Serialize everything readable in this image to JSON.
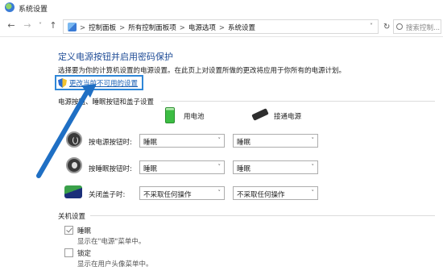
{
  "window": {
    "title": "系统设置"
  },
  "nav": {
    "back_icon": "arrow-left-icon",
    "forward_icon": "arrow-right-icon",
    "up_icon": "arrow-up-icon",
    "breadcrumbs": [
      "控制面板",
      "所有控制面板项",
      "电源选项",
      "系统设置"
    ],
    "search_placeholder": "搜索控制..."
  },
  "page": {
    "heading": "定义电源按钮并启用密码保护",
    "subtext": "选择要为你的计算机设置的电源设置。在此页上对设置所做的更改将应用于你所有的电源计划。",
    "change_link": "更改当前不可用的设置",
    "section_power": "电源按钮、睡眠按钮和盖子设置",
    "col_battery": "用电池",
    "col_plugged": "接通电源",
    "rows": [
      {
        "label": "按电源按钮时:",
        "battery": "睡眠",
        "plugged": "睡眠"
      },
      {
        "label": "按睡眠按钮时:",
        "battery": "睡眠",
        "plugged": "睡眠"
      },
      {
        "label": "关闭盖子时:",
        "battery": "不采取任何操作",
        "plugged": "不采取任何操作"
      }
    ],
    "section_shutdown": "关机设置",
    "options": [
      {
        "label": "睡眠",
        "desc": "显示在\"电源\"菜单中。",
        "checked": true
      },
      {
        "label": "锁定",
        "desc": "显示在用户头像菜单中。",
        "checked": false
      }
    ]
  },
  "annotation": {
    "color": "#1f6fc4"
  }
}
